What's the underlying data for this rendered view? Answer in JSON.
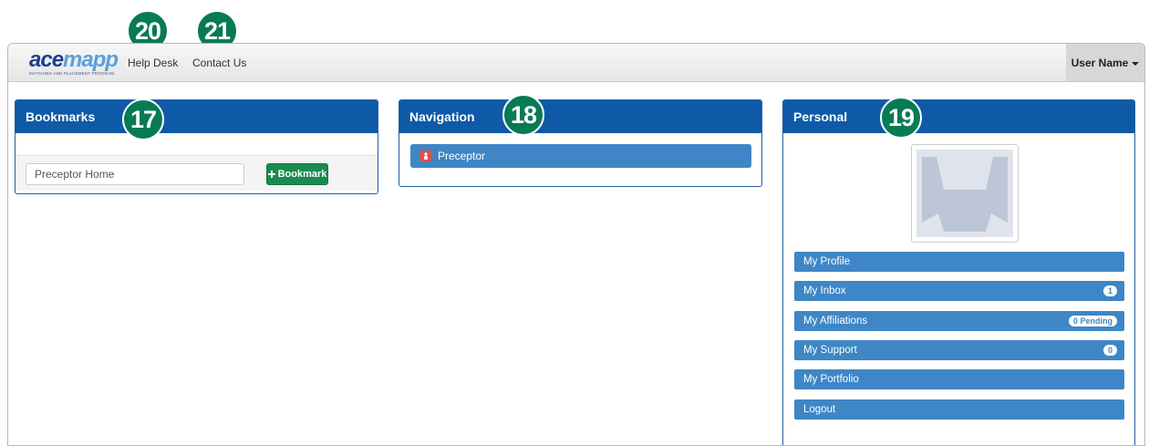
{
  "app": {
    "logo_word_a": "ace",
    "logo_word_b": "mapp",
    "logo_tagline": "MATCHING AND PLACEMENT PROGRAM",
    "brand_color": "#0e5aa6"
  },
  "topbar": {
    "help_desk": "Help Desk",
    "contact_us": "Contact Us",
    "user_name": "User Name"
  },
  "markers": {
    "bookmarks": "17",
    "navigation": "18",
    "personal": "19",
    "help_desk": "20",
    "contact_us": "21",
    "color": "#087a55"
  },
  "bookmarks": {
    "title": "Bookmarks",
    "input_value": "Preceptor Home",
    "button_label": "Bookmark",
    "button_icon": "plus-icon"
  },
  "navigation": {
    "title": "Navigation",
    "items": [
      {
        "label": "Preceptor",
        "icon": "user-icon"
      }
    ]
  },
  "personal": {
    "title": "Personal",
    "avatar": "default-profile-silhouette",
    "menu": [
      {
        "label": "My Profile",
        "badge": ""
      },
      {
        "label": "My Inbox",
        "badge": "1"
      },
      {
        "label": "My Affiliations",
        "badge": "0 Pending"
      },
      {
        "label": "My Support",
        "badge": "0"
      },
      {
        "label": "My Portfolio",
        "badge": ""
      },
      {
        "label": "Logout",
        "badge": ""
      }
    ]
  }
}
